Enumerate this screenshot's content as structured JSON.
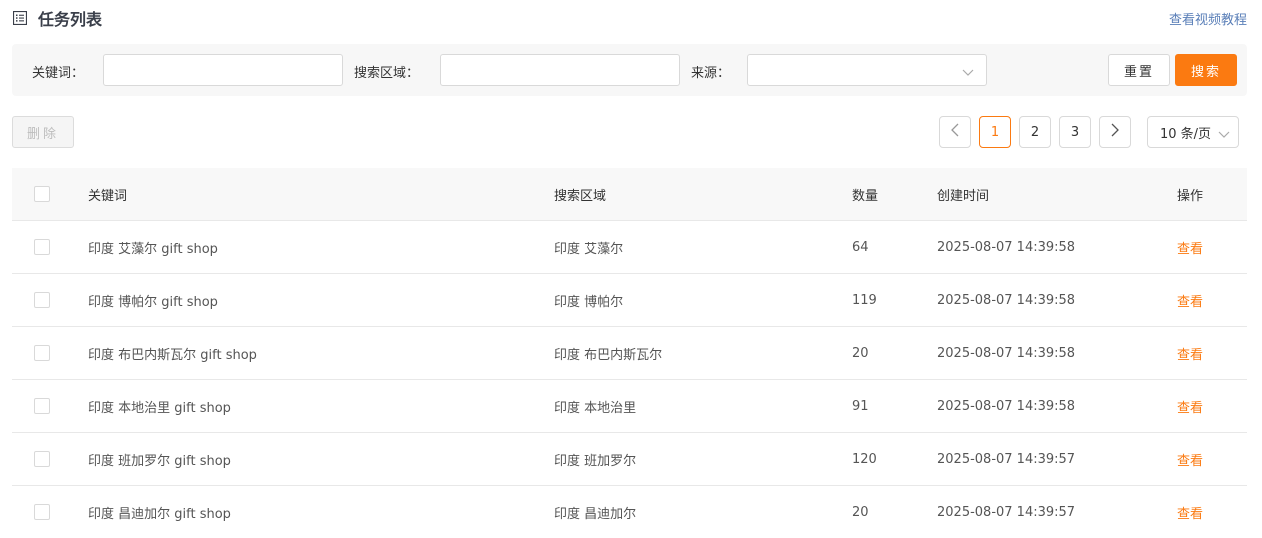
{
  "header": {
    "title": "任务列表",
    "help_link": "查看视频教程"
  },
  "filters": {
    "keyword_label": "关键词：",
    "keyword_value": "",
    "area_label": "搜索区域：",
    "area_value": "",
    "source_label": "来源：",
    "source_value": "",
    "reset_label": "重置",
    "search_label": "搜索"
  },
  "toolbar": {
    "delete_label": "删除"
  },
  "pagination": {
    "pages": [
      "1",
      "2",
      "3"
    ],
    "current": "1",
    "page_size": "10 条/页"
  },
  "table": {
    "columns": {
      "keyword": "关键词",
      "area": "搜索区域",
      "qty": "数量",
      "time": "创建时间",
      "op": "操作"
    },
    "rows": [
      {
        "keyword": "印度 艾藻尔 gift shop",
        "area": "印度 艾藻尔",
        "qty": "64",
        "time": "2025-08-07 14:39:58",
        "op": "查看"
      },
      {
        "keyword": "印度 博帕尔 gift shop",
        "area": "印度 博帕尔",
        "qty": "119",
        "time": "2025-08-07 14:39:58",
        "op": "查看"
      },
      {
        "keyword": "印度 布巴内斯瓦尔 gift shop",
        "area": "印度 布巴内斯瓦尔",
        "qty": "20",
        "time": "2025-08-07 14:39:58",
        "op": "查看"
      },
      {
        "keyword": "印度 本地治里 gift shop",
        "area": "印度 本地治里",
        "qty": "91",
        "time": "2025-08-07 14:39:58",
        "op": "查看"
      },
      {
        "keyword": "印度 班加罗尔 gift shop",
        "area": "印度 班加罗尔",
        "qty": "120",
        "time": "2025-08-07 14:39:57",
        "op": "查看"
      },
      {
        "keyword": "印度 昌迪加尔 gift shop",
        "area": "印度 昌迪加尔",
        "qty": "20",
        "time": "2025-08-07 14:39:57",
        "op": "查看"
      }
    ]
  },
  "colors": {
    "accent": "#fb7a11",
    "link": "#5a7fb8",
    "filter_bg": "#f7f7f7",
    "header_bg": "#f8f8f8",
    "border": "#e8e8e8"
  },
  "icons": {
    "title": "list-icon",
    "select": "chevron-down-icon",
    "prev": "chevron-left-icon",
    "next": "chevron-right-icon"
  }
}
